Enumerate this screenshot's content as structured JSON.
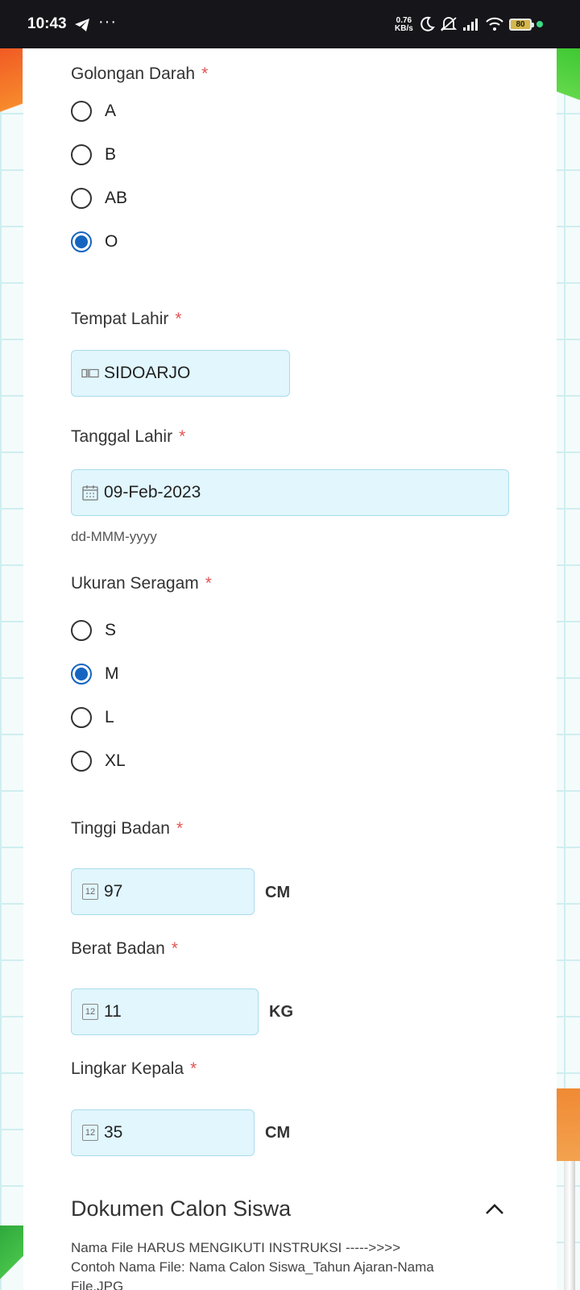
{
  "status_bar": {
    "time": "10:43",
    "telegram_icon": "telegram-icon",
    "more": "···",
    "net_speed_value": "0.76",
    "net_speed_unit": "KB/s",
    "battery": "80"
  },
  "golongan_darah": {
    "label": "Golongan Darah",
    "required": "*",
    "options": [
      {
        "label": "A",
        "checked": false
      },
      {
        "label": "B",
        "checked": false
      },
      {
        "label": "AB",
        "checked": false
      },
      {
        "label": "O",
        "checked": true
      }
    ]
  },
  "tempat_lahir": {
    "label": "Tempat Lahir",
    "required": "*",
    "value": "SIDOARJO"
  },
  "tanggal_lahir": {
    "label": "Tanggal Lahir",
    "required": "*",
    "value": "09-Feb-2023",
    "hint": "dd-MMM-yyyy"
  },
  "ukuran_seragam": {
    "label": "Ukuran Seragam",
    "required": "*",
    "options": [
      {
        "label": "S",
        "checked": false
      },
      {
        "label": "M",
        "checked": true
      },
      {
        "label": "L",
        "checked": false
      },
      {
        "label": "XL",
        "checked": false
      }
    ]
  },
  "tinggi_badan": {
    "label": "Tinggi Badan",
    "required": "*",
    "value": "97",
    "unit": "CM",
    "icon_text": "12"
  },
  "berat_badan": {
    "label": "Berat Badan",
    "required": "*",
    "value": "11",
    "unit": "KG",
    "icon_text": "12"
  },
  "lingkar_kepala": {
    "label": "Lingkar Kepala",
    "required": "*",
    "value": "35",
    "unit": "CM",
    "icon_text": "12"
  },
  "dokumen": {
    "title": "Dokumen Calon Siswa",
    "note_line1": "Nama File HARUS MENGIKUTI INSTRUKSI ----->>>>",
    "note_line2": "Contoh Nama File: Nama Calon Siswa_Tahun Ajaran-Nama File.JPG"
  },
  "colors": {
    "accent": "#1565c0",
    "field_bg": "#e1f6fd",
    "required": "#e05555"
  }
}
